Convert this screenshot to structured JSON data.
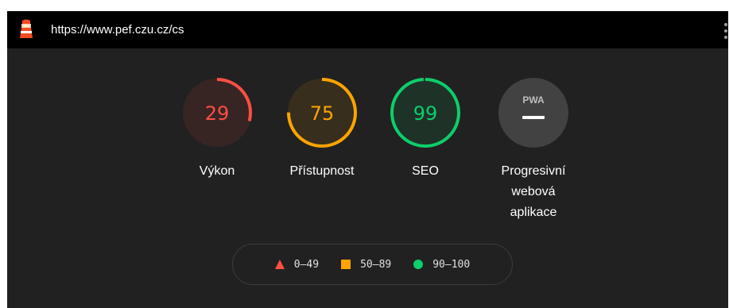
{
  "header": {
    "url": "https://www.pef.czu.cz/cs",
    "logo_icon": "lighthouse-icon",
    "menu_icon": "more-vertical-icon"
  },
  "gauges": [
    {
      "label": "Výkon",
      "score": "29",
      "value": 0.29,
      "status": "fail",
      "color": "#ff4e42"
    },
    {
      "label": "Přístupnost",
      "score": "75",
      "value": 0.75,
      "status": "average",
      "color": "#ffa400"
    },
    {
      "label": "SEO",
      "score": "99",
      "value": 0.99,
      "status": "pass",
      "color": "#0cce6b"
    },
    {
      "label": "Progresivní webová aplikace",
      "badge": "PWA",
      "score": "—",
      "status": "neutral",
      "color": "#ffffff"
    }
  ],
  "legend": [
    {
      "shape": "triangle-icon",
      "range": "0–49",
      "color": "#ff4e42"
    },
    {
      "shape": "square-icon",
      "range": "50–89",
      "color": "#ffa400"
    },
    {
      "shape": "circle-icon",
      "range": "90–100",
      "color": "#0cce6b"
    }
  ],
  "colors": {
    "background": "#212121",
    "topbar": "#000000",
    "fail": "#ff4e42",
    "average": "#ffa400",
    "pass": "#0cce6b"
  }
}
